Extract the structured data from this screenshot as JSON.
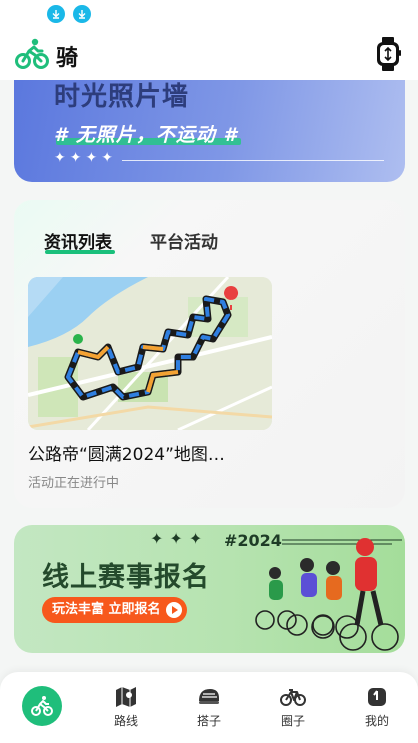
{
  "status_bar": {
    "icons": [
      "download-icon",
      "download-icon"
    ]
  },
  "header": {
    "title": "骑",
    "logo": "cyclist-logo-icon",
    "right_icon": "smartwatch-icon"
  },
  "banner_photo": {
    "title": "时光照片墙",
    "tag": "# 无照片，不运动 #",
    "sparkles": "✦✦✦✦"
  },
  "news": {
    "tabs": [
      {
        "label": "资讯列表",
        "active": true
      },
      {
        "label": "平台活动",
        "active": false
      }
    ],
    "items": [
      {
        "title": "公路帝“圆满2024”地图…",
        "status": "活动正在进行中"
      }
    ]
  },
  "register_banner": {
    "deco": "✦✦✦",
    "year": "#2024",
    "title": "线上赛事报名",
    "button_label": "玩法丰富 立即报名"
  },
  "nav": {
    "items": [
      {
        "label": "",
        "icon": "cyclist-icon"
      },
      {
        "label": "路线",
        "icon": "map-route-icon"
      },
      {
        "label": "搭子",
        "icon": "helmet-icon"
      },
      {
        "label": "圈子",
        "icon": "bicycle-icon"
      },
      {
        "label": "我的",
        "icon": "user-icon"
      }
    ]
  },
  "colors": {
    "accent": "#1fbe7b",
    "banner_blue": "#5b78de",
    "button_orange": "#f7581c"
  }
}
